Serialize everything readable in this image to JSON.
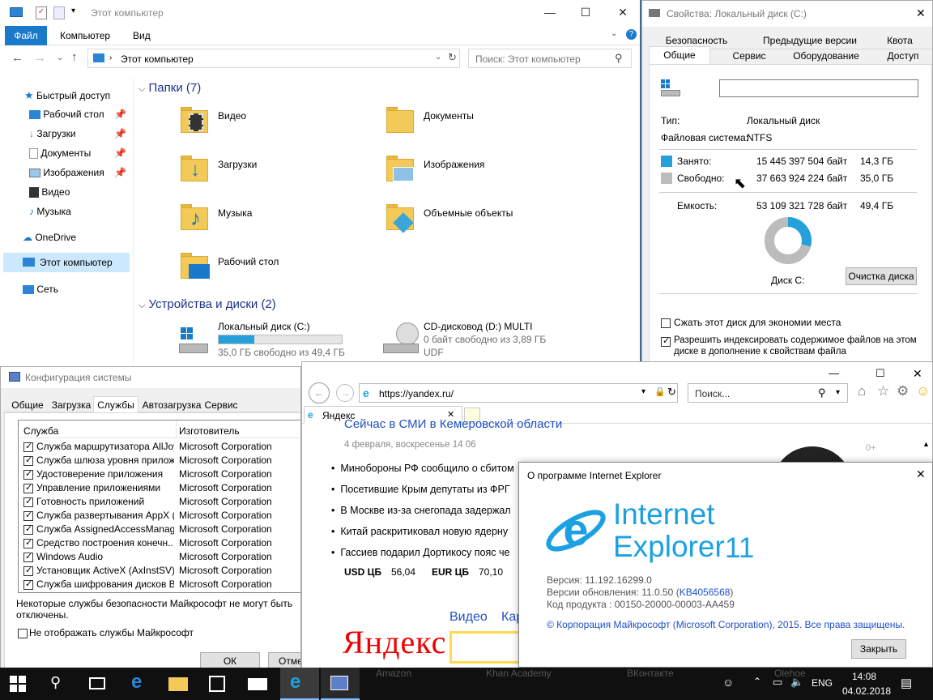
{
  "explorer": {
    "title": "Этот компьютер",
    "menu": [
      "Файл",
      "Компьютер",
      "Вид"
    ],
    "address": "Этот компьютер",
    "search_placeholder": "Поиск: Этот компьютер",
    "nav": [
      {
        "label": "Быстрый доступ"
      },
      {
        "label": "Рабочий стол"
      },
      {
        "label": "Загрузки"
      },
      {
        "label": "Документы"
      },
      {
        "label": "Изображения"
      },
      {
        "label": "Видео"
      },
      {
        "label": "Музыка"
      },
      {
        "label": "OneDrive"
      },
      {
        "label": "Этот компьютер"
      },
      {
        "label": "Сеть"
      }
    ],
    "folders_header": "Папки (7)",
    "folders": [
      "Видео",
      "Документы",
      "Загрузки",
      "Изображения",
      "Музыка",
      "Объемные объекты",
      "Рабочий стол"
    ],
    "devices_header": "Устройства и диски (2)",
    "drive_c": {
      "name": "Локальный диск (C:)",
      "info": "35,0 ГБ свободно из 49,4 ГБ",
      "used_fraction": 0.29
    },
    "drive_d": {
      "name": "CD-дисковод (D:) MULTI",
      "info": "0 байт свободно из 3,89 ГБ",
      "fs": "UDF"
    }
  },
  "props": {
    "title": "Свойства: Локальный диск (C:)",
    "tabs_row1": [
      "Безопасность",
      "Предыдущие версии",
      "Квота"
    ],
    "tabs_row2": [
      "Общие",
      "Сервис",
      "Оборудование",
      "Доступ"
    ],
    "type_label": "Тип:",
    "type_value": "Локальный диск",
    "fs_label": "Файловая система:",
    "fs_value": "NTFS",
    "used_label": "Занято:",
    "used_bytes": "15 445 397 504 байт",
    "used_gb": "14,3 ГБ",
    "free_label": "Свободно:",
    "free_bytes": "37 663 924 224 байт",
    "free_gb": "35,0 ГБ",
    "cap_label": "Емкость:",
    "cap_bytes": "53 109 321 728 байт",
    "cap_gb": "49,4 ГБ",
    "disk_label": "Диск C:",
    "cleanup": "Очистка диска",
    "compress": "Сжать этот диск для экономии места",
    "index1": "Разрешить индексировать содержимое файлов на этом",
    "index2": "диске в дополнение к свойствам файла",
    "used_color": "#26a0da",
    "free_color": "#bcbcbc"
  },
  "msconfig": {
    "title": "Конфигурация системы",
    "tabs": [
      "Общие",
      "Загрузка",
      "Службы",
      "Автозагрузка",
      "Сервис"
    ],
    "col_service": "Служба",
    "col_maker": "Изготовитель",
    "rows": [
      {
        "s": "Служба маршрутизатора AllJoyn",
        "m": "Microsoft Corporation"
      },
      {
        "s": "Служба шлюза уровня прилож...",
        "m": "Microsoft Corporation"
      },
      {
        "s": "Удостоверение приложения",
        "m": "Microsoft Corporation"
      },
      {
        "s": "Управление приложениями",
        "m": "Microsoft Corporation"
      },
      {
        "s": "Готовность приложений",
        "m": "Microsoft Corporation"
      },
      {
        "s": "Служба развертывания AppX (...",
        "m": "Microsoft Corporation"
      },
      {
        "s": "Служба AssignedAccessManager",
        "m": "Microsoft Corporation"
      },
      {
        "s": "Средство построения конечн...",
        "m": "Microsoft Corporation"
      },
      {
        "s": "Windows Audio",
        "m": "Microsoft Corporation"
      },
      {
        "s": "Установщик ActiveX (AxInstSV)",
        "m": "Microsoft Corporation"
      },
      {
        "s": "Служба шифрования дисков Bi...",
        "m": "Microsoft Corporation"
      }
    ],
    "note1": "Некоторые службы безопасности Майкрософт не могут быть",
    "note2": "отключены.",
    "hide_ms": "Не отображать службы Майкрософт",
    "ok": "ОК",
    "cancel": "Отме"
  },
  "ie": {
    "url": "https://yandex.ru/",
    "search_placeholder": "Поиск...",
    "tab": "Яндекс",
    "news_top": "Сейчас в СМИ  в Кемеровской области",
    "date": "4 февраля, воскресенье 14 06",
    "news": [
      "Минобороны РФ сообщило о сбитом",
      "Посетившие Крым депутаты из ФРГ",
      "В Москве из-за снегопада задержал",
      "Китай раскритиковал новую ядерну",
      "Гассиев подарил Дортикосу пояс че"
    ],
    "usd_label": "USD ЦБ",
    "usd": "56,04",
    "eur_label": "EUR ЦБ",
    "eur": "70,10",
    "video_link": "Видео",
    "kart_link": "Кар",
    "logo": "Яндекс",
    "plus": "0+"
  },
  "about": {
    "title": "О программе Internet Explorer",
    "name1": "Internet",
    "name2": "Explorer",
    "ver_num": "11",
    "version": "Версия: 11.192.16299.0",
    "updates_prefix": "Версии обновления: 11.0.50 (",
    "updates_kb": "KB4056568",
    "updates_suffix": ")",
    "product": "Код продукта : 00150-20000-00003-AA459",
    "copyright": "© Корпорация Майкрософт (Microsoft Corporation), 2015. Все права защищены.",
    "close": "Закрыть",
    "brand_color": "#1ba1e2"
  },
  "taskbar": {
    "ghost": [
      "Amazon",
      "Khan Academy",
      "ВКонтакте",
      "Olehoe"
    ],
    "lang": "ENG",
    "time": "14:08",
    "date": "04.02.2018"
  }
}
